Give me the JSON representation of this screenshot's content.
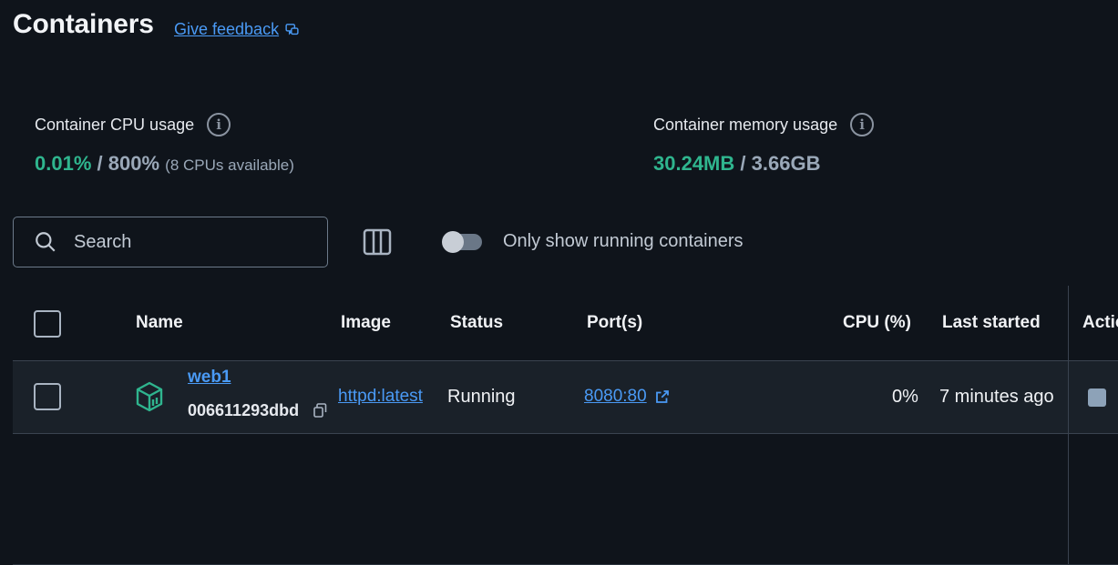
{
  "header": {
    "title": "Containers",
    "feedback_label": "Give feedback",
    "feedback_icon": "chat-feedback-icon"
  },
  "stats": {
    "cpu": {
      "label": "Container CPU usage",
      "used": "0.01%",
      "separator": "/",
      "total": "800%",
      "note": "(8 CPUs available)"
    },
    "memory": {
      "label": "Container memory usage",
      "used": "30.24MB",
      "separator": "/",
      "total": "3.66GB"
    },
    "info_icon_glyph": "i"
  },
  "toolbar": {
    "search_placeholder": "Search",
    "toggle_label": "Only show running containers",
    "toggle_on": false
  },
  "table": {
    "columns": {
      "name": "Name",
      "image": "Image",
      "status": "Status",
      "ports": "Port(s)",
      "cpu": "CPU (%)",
      "last_started": "Last started",
      "actions": "Actions"
    },
    "rows": [
      {
        "name": "web1",
        "id": "006611293dbd",
        "image": "httpd:latest",
        "status": "Running",
        "ports": "8080:80",
        "cpu": "0%",
        "last_started": "7 minutes ago"
      }
    ]
  },
  "colors": {
    "background": "#0f141b",
    "accent_link": "#4a9af5",
    "usage_green": "#2fb58e",
    "container_icon": "#2fb58e"
  }
}
